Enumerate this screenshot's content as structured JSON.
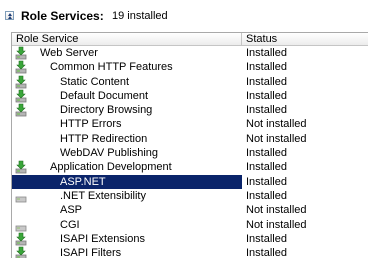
{
  "section": {
    "title": "Role Services:",
    "count": "19 installed"
  },
  "columns": {
    "service": "Role Service",
    "status": "Status"
  },
  "rows": [
    {
      "name": "Web Server",
      "status": "Installed",
      "level": 1,
      "icon": "installed-icon"
    },
    {
      "name": "Common HTTP Features",
      "status": "Installed",
      "level": 2,
      "icon": "installed-icon"
    },
    {
      "name": "Static Content",
      "status": "Installed",
      "level": 3,
      "icon": "installed-icon"
    },
    {
      "name": "Default Document",
      "status": "Installed",
      "level": 3,
      "icon": "installed-icon"
    },
    {
      "name": "Directory Browsing",
      "status": "Installed",
      "level": 3,
      "icon": "installed-icon"
    },
    {
      "name": "HTTP Errors",
      "status": "Not installed",
      "level": 3,
      "icon": ""
    },
    {
      "name": "HTTP Redirection",
      "status": "Not installed",
      "level": 3,
      "icon": ""
    },
    {
      "name": "WebDAV Publishing",
      "status": "Installed",
      "level": 3,
      "icon": ""
    },
    {
      "name": "Application Development",
      "status": "Installed",
      "level": 2,
      "icon": "installed-icon"
    },
    {
      "name": "ASP.NET",
      "status": "Installed",
      "level": 3,
      "icon": "installed-icon",
      "selected": true
    },
    {
      "name": ".NET Extensibility",
      "status": "Installed",
      "level": 3,
      "icon": "not-installed-icon"
    },
    {
      "name": "ASP",
      "status": "Not installed",
      "level": 3,
      "icon": ""
    },
    {
      "name": "CGI",
      "status": "Not installed",
      "level": 3,
      "icon": "not-installed-icon"
    },
    {
      "name": "ISAPI Extensions",
      "status": "Installed",
      "level": 3,
      "icon": "installed-icon"
    },
    {
      "name": "ISAPI Filters",
      "status": "Installed",
      "level": 3,
      "icon": "installed-icon"
    }
  ],
  "colors": {
    "selection": "#0a246a",
    "installed_arrow": "#2e9b2e",
    "server_gray": "#9a9a9a"
  }
}
